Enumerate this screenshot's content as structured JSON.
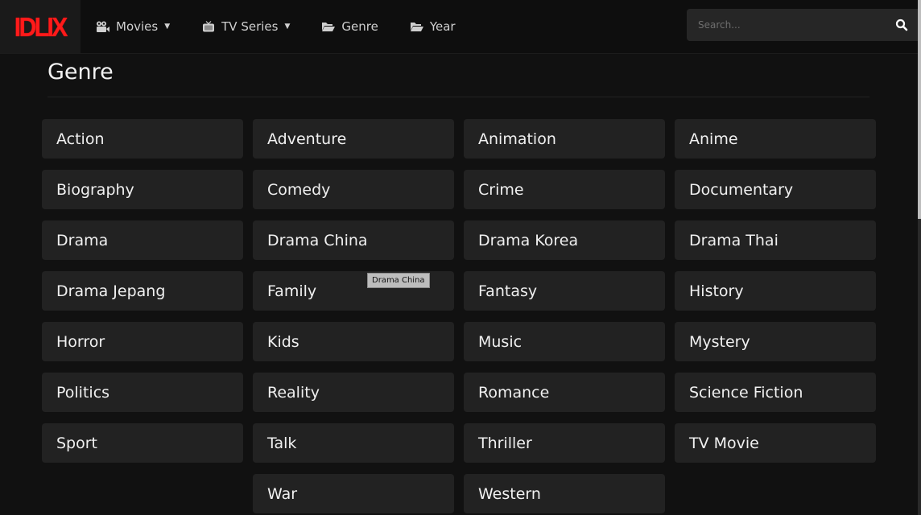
{
  "header": {
    "logo_text": "IDLIX",
    "nav": [
      {
        "label": "Movies",
        "icon": "film-camera-icon",
        "has_dropdown": true
      },
      {
        "label": "TV Series",
        "icon": "tv-icon",
        "has_dropdown": true
      },
      {
        "label": "Genre",
        "icon": "folder-open-icon",
        "has_dropdown": false
      },
      {
        "label": "Year",
        "icon": "folder-open-icon",
        "has_dropdown": false
      }
    ],
    "search": {
      "placeholder": "Search...",
      "value": "",
      "icon": "search-icon"
    }
  },
  "main": {
    "title": "Genre",
    "genres": [
      "Action",
      "Adventure",
      "Animation",
      "Anime",
      "Biography",
      "Comedy",
      "Crime",
      "Documentary",
      "Drama",
      "Drama China",
      "Drama Korea",
      "Drama Thai",
      "Drama Jepang",
      "Family",
      "Fantasy",
      "History",
      "Horror",
      "Kids",
      "Music",
      "Mystery",
      "Politics",
      "Reality",
      "Romance",
      "Science Fiction",
      "Sport",
      "Talk",
      "Thriller",
      "TV Movie",
      "War",
      "Western"
    ],
    "tooltip": "Drama China"
  },
  "colors": {
    "brand": "#ff1a1a",
    "background": "#111111",
    "tile": "#222222"
  }
}
